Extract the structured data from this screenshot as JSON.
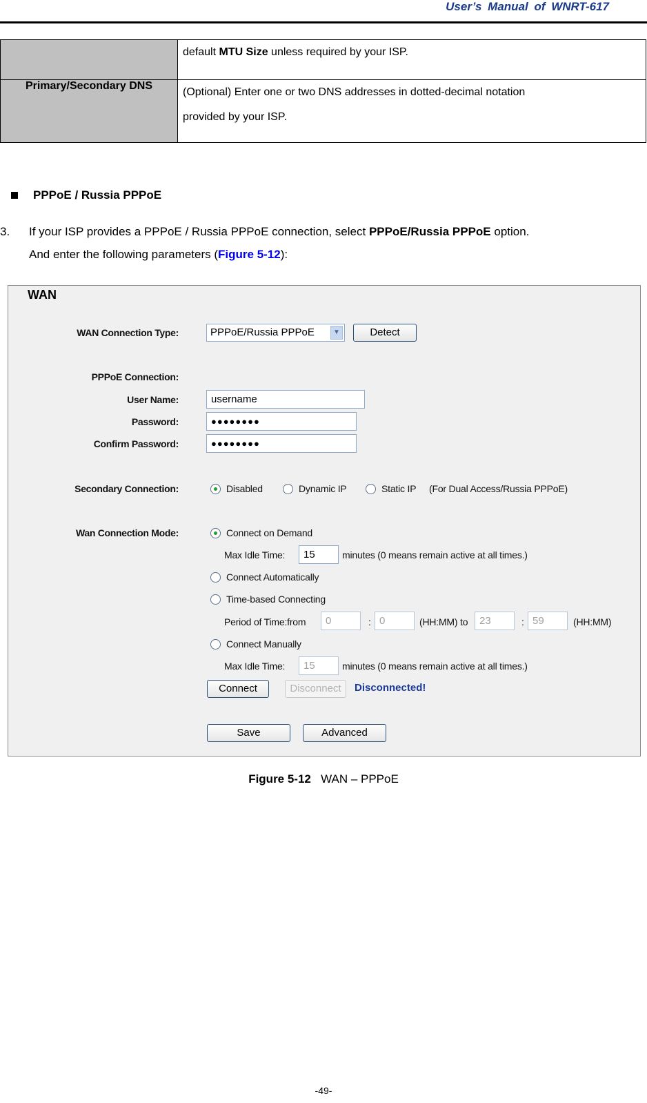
{
  "header": {
    "title": "User’s  Manual  of  WNRT-617"
  },
  "param_table": {
    "rows": [
      {
        "key": "",
        "value_parts": [
          "default ",
          "MTU Size",
          " unless required by your ISP."
        ]
      },
      {
        "key": "Primary/Secondary DNS",
        "value_lines": [
          "(Optional) Enter one or two DNS addresses in dotted-decimal notation",
          "provided by your ISP."
        ]
      }
    ]
  },
  "section": {
    "bullet_heading": "PPPoE / Russia PPPoE",
    "step_number": "3.",
    "line1_prefix": "If your ISP provides a PPPoE / Russia PPPoE connection, select ",
    "line1_bold": "PPPoE/Russia PPPoE",
    "line1_suffix": " option.",
    "line2_prefix": "And enter the following parameters (",
    "line2_link": "Figure 5-12",
    "line2_suffix": "):"
  },
  "wan_panel": {
    "title": "WAN",
    "connection_type_label": "WAN Connection Type:",
    "connection_type_value": "PPPoE/Russia PPPoE",
    "detect_button": "Detect",
    "pppoe_connection_label": "PPPoE Connection:",
    "username_label": "User Name:",
    "username_value": "username",
    "password_label": "Password:",
    "password_value": "●●●●●●●●",
    "confirm_password_label": "Confirm Password:",
    "confirm_password_value": "●●●●●●●●",
    "secondary_label": "Secondary Connection:",
    "secondary_options": [
      {
        "label": "Disabled",
        "selected": true
      },
      {
        "label": "Dynamic IP",
        "selected": false
      },
      {
        "label": "Static IP",
        "selected": false
      }
    ],
    "secondary_note": "(For Dual Access/Russia PPPoE)",
    "mode_label": "Wan Connection Mode:",
    "mode_options": [
      {
        "label": "Connect on Demand",
        "selected": true
      },
      {
        "label": "Connect Automatically",
        "selected": false
      },
      {
        "label": "Time-based Connecting",
        "selected": false
      },
      {
        "label": "Connect Manually",
        "selected": false
      }
    ],
    "max_idle_label": "Max Idle Time:",
    "max_idle_value_demand": "15",
    "max_idle_value_manual": "15",
    "minutes_note": "minutes (0 means remain active at all times.)",
    "period_label": "Period of Time:from",
    "period_from_hh": "0",
    "period_from_mm": "0",
    "colon": ":",
    "hhmm_to": "(HH:MM) to",
    "period_to_hh": "23",
    "period_to_mm": "59",
    "hhmm": "(HH:MM)",
    "connect_button": "Connect",
    "disconnect_button": "Disconnect",
    "status_text": "Disconnected!",
    "save_button": "Save",
    "advanced_button": "Advanced"
  },
  "caption": {
    "label": "Figure 5-12",
    "text": "WAN – PPPoE"
  },
  "footer": {
    "page": "-49-"
  }
}
